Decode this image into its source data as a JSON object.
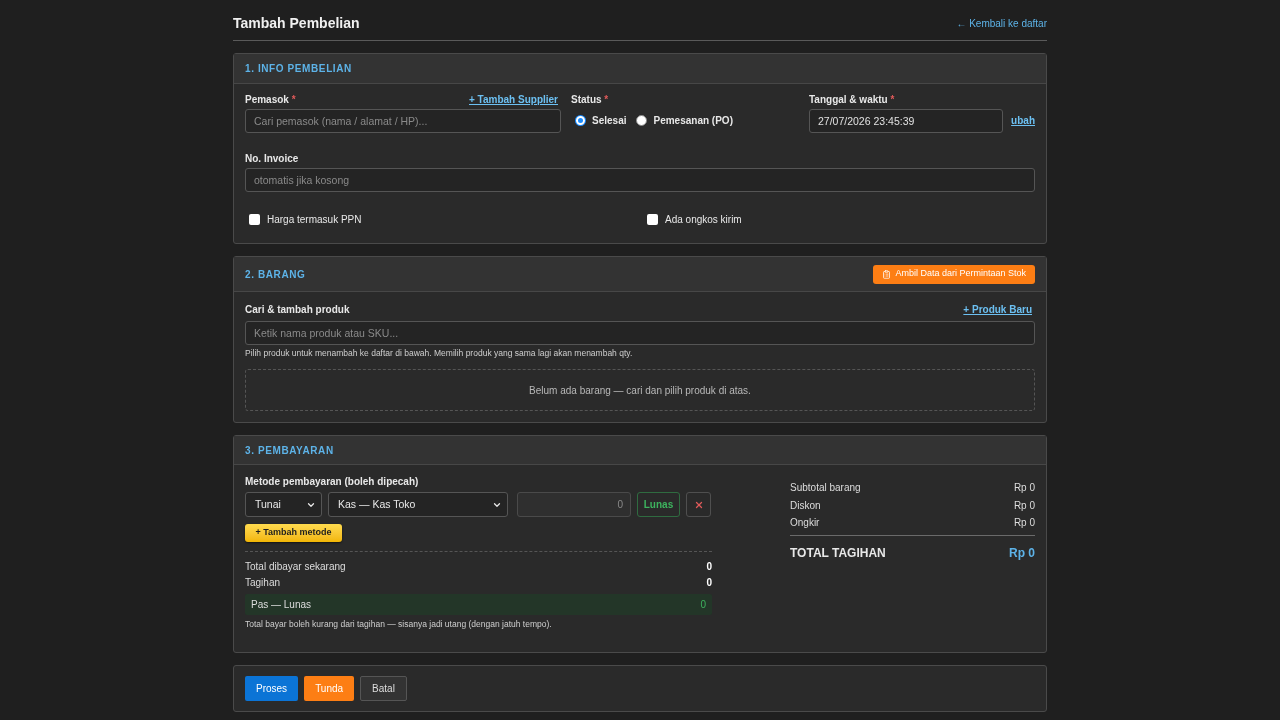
{
  "page": {
    "title": "Tambah Pembelian",
    "back_link": "← Kembali ke daftar"
  },
  "info": {
    "heading": "1. INFO PEMBELIAN",
    "supplier": {
      "label": "Pemasok",
      "required_mark": "*",
      "link": "+ Tambah Supplier",
      "placeholder": "Cari pemasok (nama / alamat / HP)..."
    },
    "status": {
      "label": "Status",
      "required_mark": "*",
      "options": [
        {
          "label": "Selesai",
          "selected": true
        },
        {
          "label": "Pemesanan (PO)",
          "selected": false
        }
      ]
    },
    "datetime": {
      "label": "Tanggal & waktu",
      "required_mark": "*",
      "value": "27/07/2026 23:45:39",
      "link": "ubah"
    },
    "invoice": {
      "label": "No. Invoice",
      "placeholder": "otomatis jika kosong"
    },
    "checkboxes": [
      {
        "label": "Harga termasuk PPN",
        "checked": false
      },
      {
        "label": "Ada ongkos kirim",
        "checked": false
      }
    ]
  },
  "items": {
    "heading": "2. BARANG",
    "import_button": "Ambil Data dari Permintaan Stok",
    "search": {
      "label": "Cari & tambah produk",
      "link": "+ Produk Baru",
      "placeholder": "Ketik nama produk atau SKU...",
      "hint": "Pilih produk untuk menambah ke daftar di bawah. Memilih produk yang sama lagi akan menambah qty."
    },
    "empty_message": "Belum ada barang — cari dan pilih produk di atas."
  },
  "payment": {
    "heading": "3. PEMBAYARAN",
    "methods_label": "Metode pembayaran (boleh dipecah)",
    "methods": [
      {
        "type": "Tunai",
        "account": "Kas — Kas Toko",
        "amount": "0",
        "settle_button": "Lunas"
      }
    ],
    "add_method_button": "+ Tambah metode",
    "totals": [
      {
        "label": "Total dibayar sekarang",
        "value": "0"
      },
      {
        "label": "Tagihan",
        "value": "0"
      }
    ],
    "balance": {
      "label": "Pas — Lunas",
      "value": "0"
    },
    "note": "Total bayar boleh kurang dari tagihan — sisanya jadi utang (dengan jatuh tempo).",
    "summary": [
      {
        "label": "Subtotal barang",
        "value": "Rp 0"
      },
      {
        "label": "Diskon",
        "value": "Rp 0"
      },
      {
        "label": "Ongkir",
        "value": "Rp 0"
      }
    ],
    "total": {
      "label": "TOTAL TAGIHAN",
      "value": "Rp 0"
    }
  },
  "actions": [
    {
      "label": "Proses",
      "kind": "primary"
    },
    {
      "label": "Tunda",
      "kind": "warning"
    },
    {
      "label": "Batal",
      "kind": "secondary"
    }
  ]
}
